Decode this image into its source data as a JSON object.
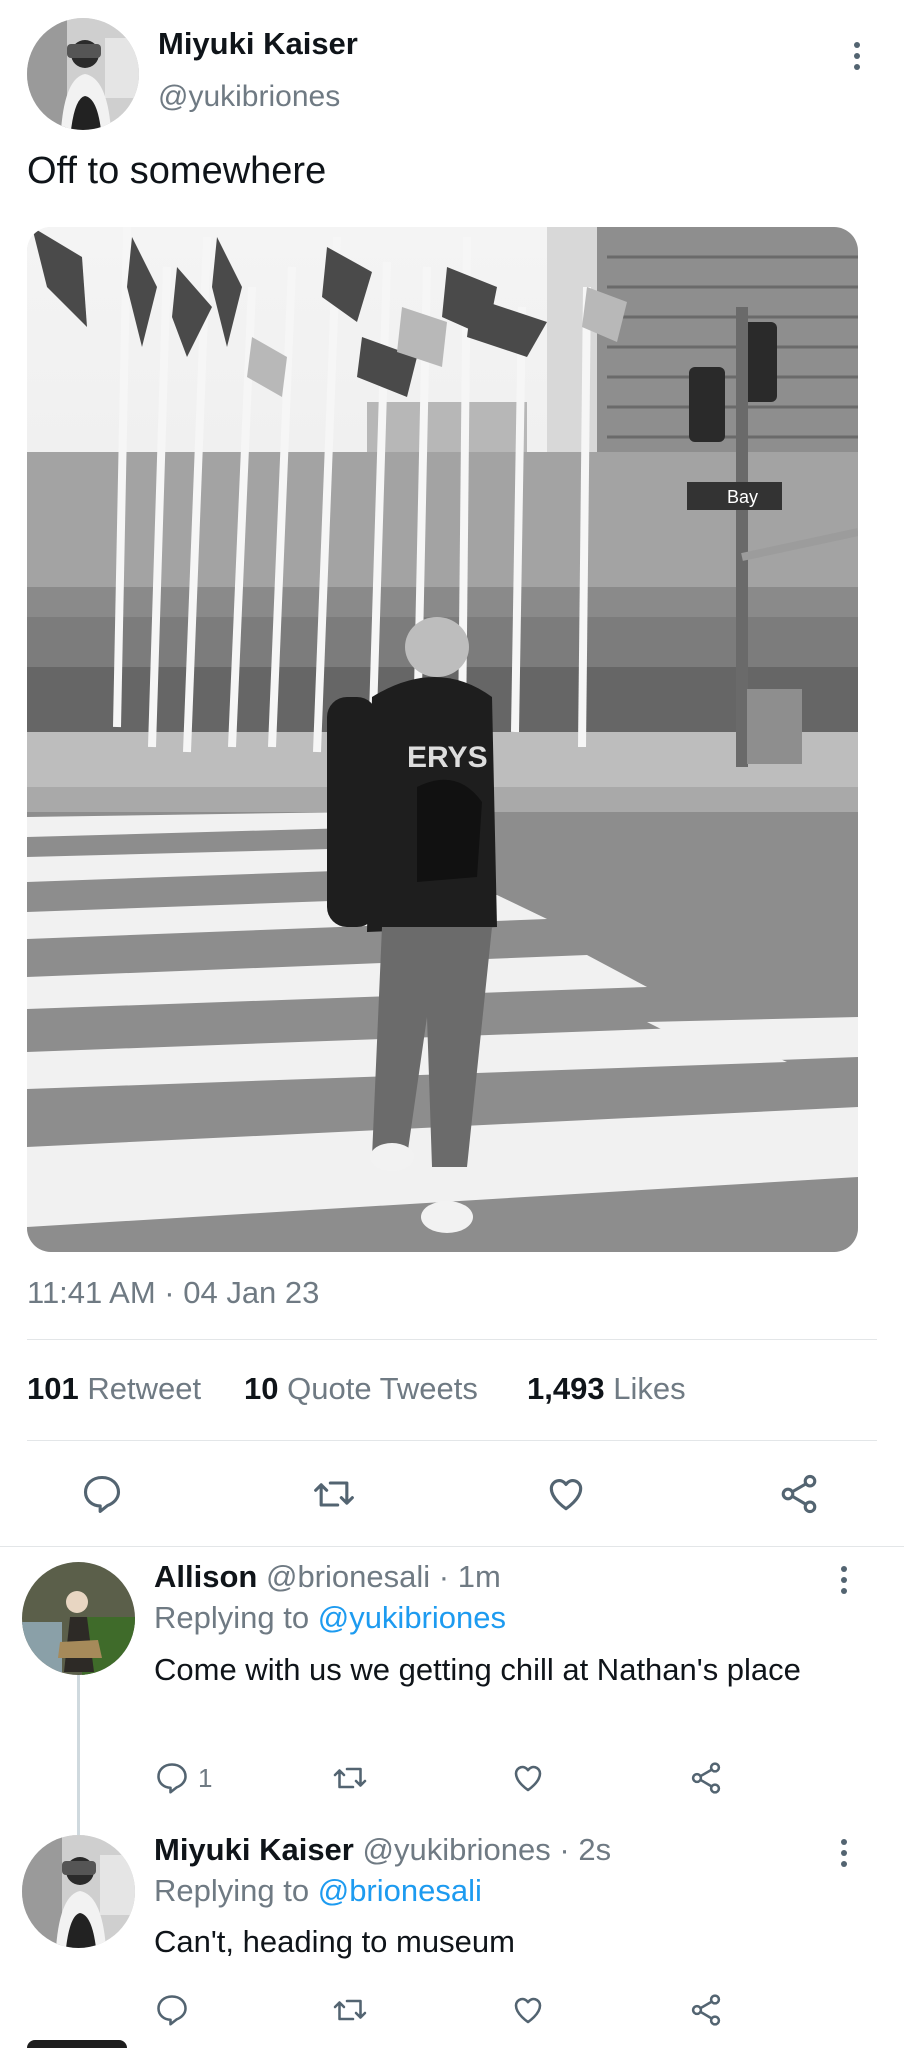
{
  "main_tweet": {
    "author_name": "Miyuki Kaiser",
    "author_handle": "@yukibriones",
    "text": "Off to somewhere",
    "image_alt": "Person in hoodie and beanie walking across a crosswalk in front of a row of flags",
    "street_sign": "Bay",
    "timestamp": "11:41 AM · 04 Jan 23",
    "stats": [
      {
        "count": "101",
        "label": "Retweet"
      },
      {
        "count": "10",
        "label": "Quote Tweets"
      },
      {
        "count": "1,493",
        "label": "Likes"
      }
    ]
  },
  "replies": [
    {
      "author_name": "Allison",
      "author_handle": "@brionesali",
      "time": "· 1m",
      "replying_label": "Replying to",
      "replying_to": "@yukibriones",
      "text": "Come with us we getting chill at Nathan's place",
      "reply_count": "1"
    },
    {
      "author_name": "Miyuki Kaiser",
      "author_handle": "@yukibriones",
      "time": "· 2s",
      "replying_label": "Replying to",
      "replying_to": "@brionesali",
      "text": "Can't, heading to museum",
      "reply_count": ""
    }
  ],
  "icons": [
    "reply-icon",
    "retweet-icon",
    "like-icon",
    "share-icon",
    "more-icon"
  ],
  "colors": {
    "link": "#1d9bf0",
    "muted": "#6f7a83",
    "text": "#0f1419",
    "divider": "#e3e6e8"
  }
}
